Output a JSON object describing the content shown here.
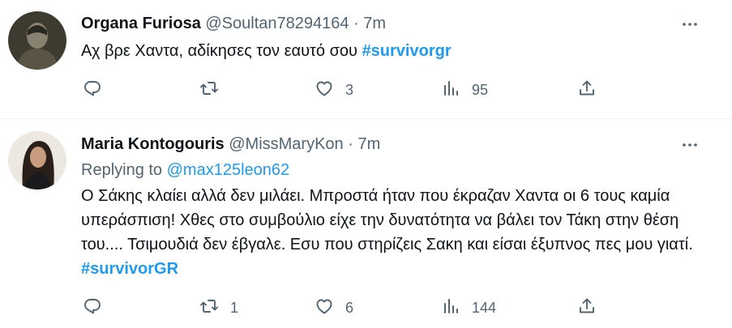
{
  "tweets": [
    {
      "name": "Organa Furiosa",
      "handle": "@Soultan78294164",
      "dot": "·",
      "time": "7m",
      "text": "Αχ βρε Χαντα, αδίκησες τον εαυτό σου ",
      "hashtag": "#survivorgr",
      "replying_label": "",
      "replying_to": "",
      "reply_count": "",
      "retweet_count": "",
      "like_count": "3",
      "view_count": "95",
      "avatar_colors": [
        "#4a4a3c",
        "#8c8a78"
      ]
    },
    {
      "name": "Maria Kontogouris",
      "handle": "@MissMaryKon",
      "dot": "·",
      "time": "7m",
      "replying_label": "Replying to ",
      "replying_to": "@max125leon62",
      "text": "Ο Σάκης κλαίει αλλά δεν μιλάει. Μπροστά ήταν που έκραζαν Χαντα οι 6 τους καμία υπεράσπιση! Χθες στο συμβούλιο είχε την δυνατότητα να βάλει τον Τάκη στην θέση του.... Τσιμουδιά δεν έβγαλε. Εσυ που στηρίζεις Σακη και είσαι έξυπνος πες μου γιατί. ",
      "hashtag": "#survivorGR",
      "reply_count": "",
      "retweet_count": "1",
      "like_count": "6",
      "view_count": "144",
      "avatar_colors": [
        "#e9e4de",
        "#2a1f1a"
      ]
    }
  ],
  "icons": {
    "reply": "reply-icon",
    "retweet": "retweet-icon",
    "like": "heart-icon",
    "views": "views-icon",
    "share": "share-icon",
    "more": "more-icon"
  },
  "colors": {
    "link": "#1d9bf0",
    "secondary_text": "#536471",
    "divider": "#eff3f4"
  }
}
